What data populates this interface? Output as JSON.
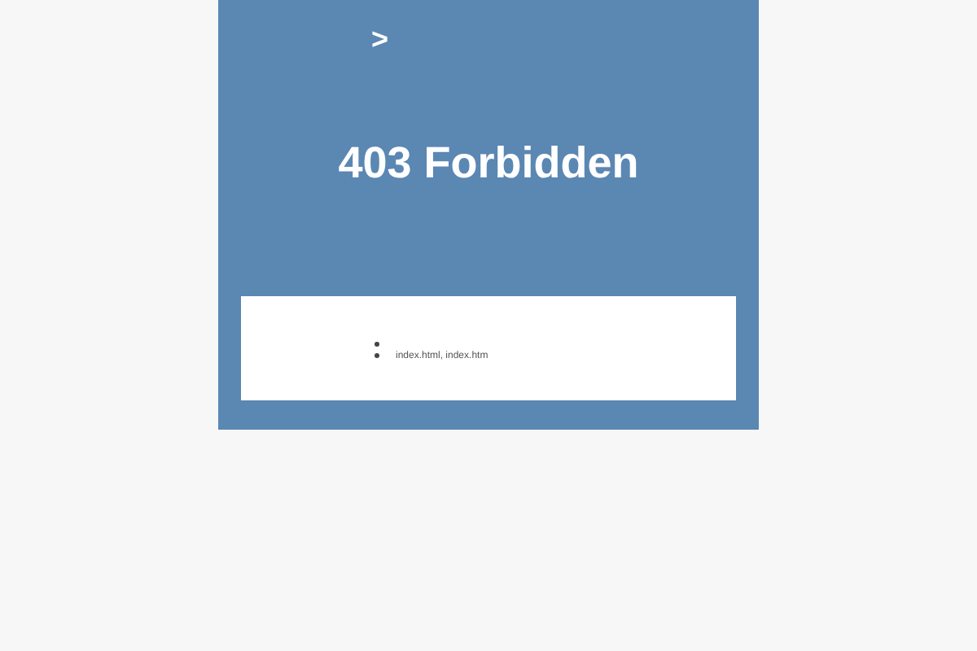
{
  "header": {
    "arrow": ">",
    "title": "403 Forbidden"
  },
  "details": {
    "items": [
      {
        "kind": "blank"
      },
      {
        "kind": "text",
        "text": "index.html, index.htm"
      }
    ]
  }
}
